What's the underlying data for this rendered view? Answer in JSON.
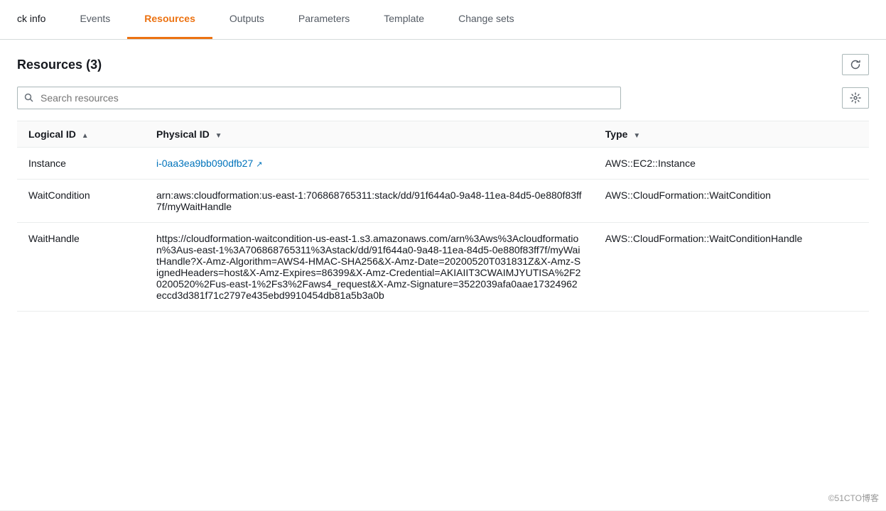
{
  "tabs": [
    {
      "id": "stack-info",
      "label": "ck info",
      "active": false
    },
    {
      "id": "events",
      "label": "Events",
      "active": false
    },
    {
      "id": "resources",
      "label": "Resources",
      "active": true
    },
    {
      "id": "outputs",
      "label": "Outputs",
      "active": false
    },
    {
      "id": "parameters",
      "label": "Parameters",
      "active": false
    },
    {
      "id": "template",
      "label": "Template",
      "active": false
    },
    {
      "id": "change-sets",
      "label": "Change sets",
      "active": false
    }
  ],
  "section": {
    "title": "Resources",
    "count": "3"
  },
  "search": {
    "placeholder": "Search resources"
  },
  "columns": {
    "logical_id": "Logical ID",
    "physical_id": "Physical ID",
    "type": "Type"
  },
  "rows": [
    {
      "logical_id": "Instance",
      "physical_id": "i-0aa3ea9bb090dfb27",
      "physical_id_is_link": true,
      "type": "AWS::EC2::Instance"
    },
    {
      "logical_id": "WaitCondition",
      "physical_id": "arn:aws:cloudformation:us-east-1:706868765311:stack/dd/91f644a0-9a48-11ea-84d5-0e880f83ff7f/myWaitHandle",
      "physical_id_is_link": false,
      "type": "AWS::CloudFormation::WaitCondition"
    },
    {
      "logical_id": "WaitHandle",
      "physical_id": "https://cloudformation-waitcondition-us-east-1.s3.amazonaws.com/arn%3Aws%3Acloudformation%3Aus-east-1%3A706868765311%3Astack/dd/91f644a0-9a48-11ea-84d5-0e880f83ff7f/myWaitHandle?X-Amz-Algorithm=AWS4-HMAC-SHA256&X-Amz-Date=20200520T031831Z&X-Amz-SignedHeaders=host&X-Amz-Expires=86399&X-Amz-Credential=AKIAIIT3CWAIMJYUTISA%2F20200520%2Fus-east-1%2Fs3%2Faws4_request&X-Amz-Signature=3522039afa0aae17324962eccd3d381f71c2797e435ebd9910454db81a5b3a0b",
      "physical_id_is_link": false,
      "type": "AWS::CloudFormation::WaitConditionHandle"
    }
  ],
  "watermark": "©51CTO博客"
}
